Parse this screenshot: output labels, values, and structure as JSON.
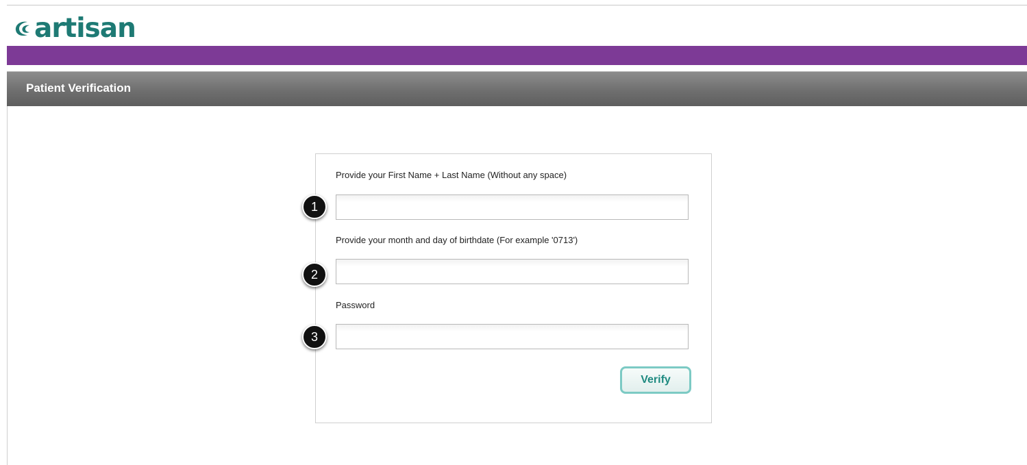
{
  "brand": {
    "logo_text": "artisan",
    "primary_color": "#1e7a74",
    "bar_color": "#7d3a96"
  },
  "page": {
    "title": "Patient Verification"
  },
  "form": {
    "name_label": "Provide your First Name + Last Name (Without any space)",
    "name_value": "",
    "birthdate_label": "Provide your month and day of birthdate (For example '0713')",
    "birthdate_value": "",
    "password_label": "Password",
    "password_value": "",
    "verify_label": "Verify"
  },
  "callouts": [
    "1",
    "2",
    "3"
  ]
}
